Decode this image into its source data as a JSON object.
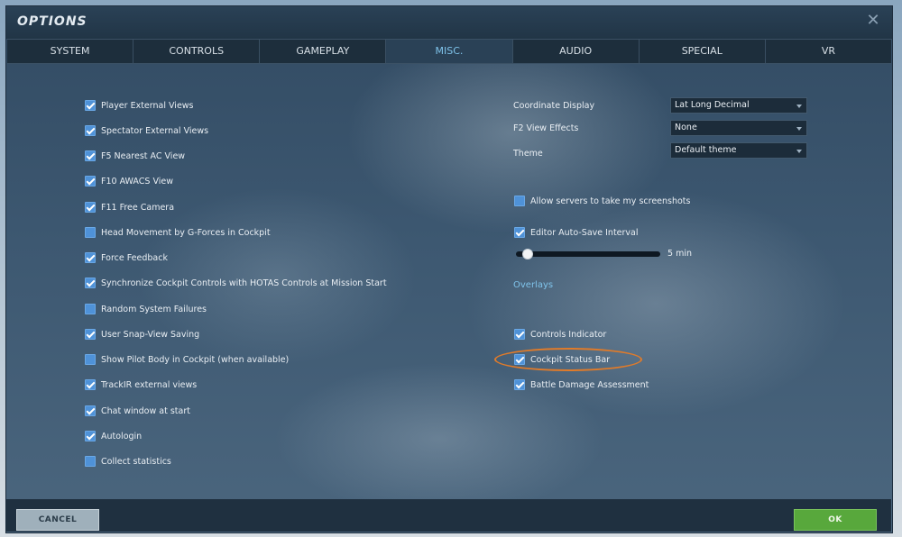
{
  "window": {
    "title": "OPTIONS"
  },
  "tabs": [
    {
      "label": "SYSTEM"
    },
    {
      "label": "CONTROLS"
    },
    {
      "label": "GAMEPLAY"
    },
    {
      "label": "MISC."
    },
    {
      "label": "AUDIO"
    },
    {
      "label": "SPECIAL"
    },
    {
      "label": "VR"
    }
  ],
  "active_tab": "MISC.",
  "left_options": [
    {
      "label": "Player External Views",
      "checked": true
    },
    {
      "label": "Spectator External Views",
      "checked": true
    },
    {
      "label": "F5 Nearest AC View",
      "checked": true
    },
    {
      "label": "F10 AWACS View",
      "checked": true
    },
    {
      "label": "F11 Free Camera",
      "checked": true
    },
    {
      "label": "Head Movement by G-Forces in Cockpit",
      "checked": false
    },
    {
      "label": "Force Feedback",
      "checked": true
    },
    {
      "label": "Synchronize Cockpit Controls with HOTAS Controls at Mission Start",
      "checked": true
    },
    {
      "label": "Random System Failures",
      "checked": false
    },
    {
      "label": "User Snap-View Saving",
      "checked": true
    },
    {
      "label": "Show Pilot Body in Cockpit (when available)",
      "checked": false
    },
    {
      "label": "TrackIR external views",
      "checked": true
    },
    {
      "label": "Chat window at start",
      "checked": true
    },
    {
      "label": "Autologin",
      "checked": true
    },
    {
      "label": "Collect statistics",
      "checked": false
    }
  ],
  "dropdowns": [
    {
      "label": "Coordinate Display",
      "value": "Lat Long Decimal"
    },
    {
      "label": "F2 View Effects",
      "value": "None"
    },
    {
      "label": "Theme",
      "value": "Default theme"
    }
  ],
  "allow_screenshots": {
    "label": "Allow servers to take my screenshots",
    "checked": false
  },
  "autosave": {
    "label": "Editor Auto-Save Interval",
    "checked": true,
    "value_text": "5 min",
    "level": 0.05
  },
  "overlays": {
    "title": "Overlays",
    "items": [
      {
        "label": "Controls Indicator",
        "checked": true
      },
      {
        "label": "Cockpit Status Bar",
        "checked": true
      },
      {
        "label": "Battle Damage Assessment",
        "checked": true
      }
    ]
  },
  "footer": {
    "cancel_label": "CANCEL",
    "ok_label": "OK"
  },
  "colors": {
    "accent": "#7fc3ea",
    "checkbox": "#4f92d8",
    "ok_button": "#58a83c",
    "highlight": "#e07b2a"
  }
}
